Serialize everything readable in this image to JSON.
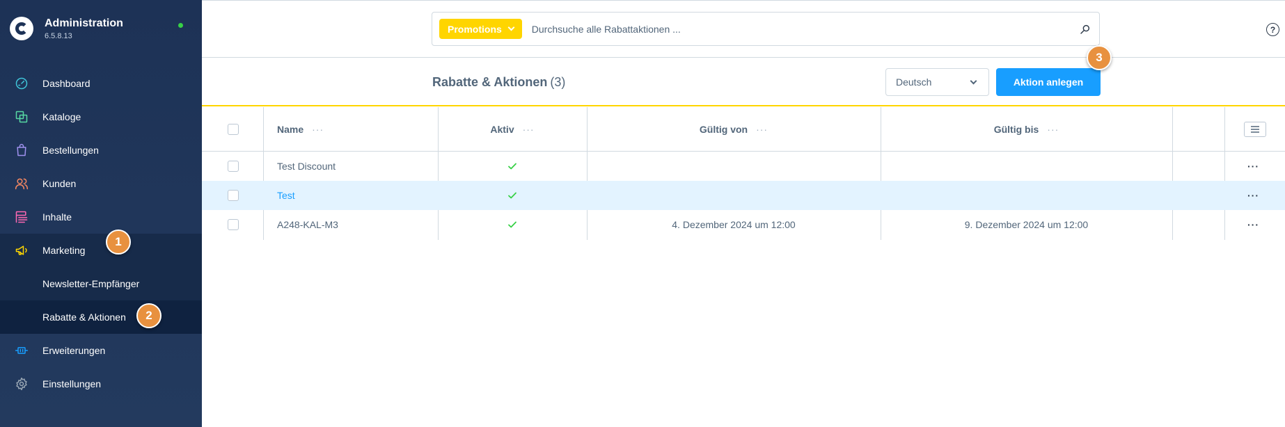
{
  "brand": {
    "title": "Administration",
    "version": "6.5.8.13"
  },
  "sidebar": {
    "items": [
      {
        "label": "Dashboard",
        "icon": "gauge-icon",
        "color": "#3fc4d8"
      },
      {
        "label": "Kataloge",
        "icon": "catalog-icon",
        "color": "#57d9a3"
      },
      {
        "label": "Bestellungen",
        "icon": "shopping-bag-icon",
        "color": "#a092f0"
      },
      {
        "label": "Kunden",
        "icon": "users-icon",
        "color": "#f88962"
      },
      {
        "label": "Inhalte",
        "icon": "content-icon",
        "color": "#ff68b4"
      },
      {
        "label": "Marketing",
        "icon": "megaphone-icon",
        "color": "#ffd700"
      },
      {
        "label": "Newsletter-Empfänger"
      },
      {
        "label": "Rabatte & Aktionen"
      },
      {
        "label": "Erweiterungen",
        "icon": "plug-icon",
        "color": "#189eff"
      },
      {
        "label": "Einstellungen",
        "icon": "gear-icon",
        "color": "#9aa8b5"
      }
    ]
  },
  "badges": [
    "1",
    "2",
    "3"
  ],
  "search": {
    "type_label": "Promotions",
    "placeholder": "Durchsuche alle Rabattaktionen ..."
  },
  "header": {
    "title": "Rabatte & Aktionen",
    "count": "(3)",
    "language": "Deutsch",
    "create_label": "Aktion anlegen"
  },
  "table": {
    "columns": [
      "Name",
      "Aktiv",
      "Gültig von",
      "Gültig bis"
    ],
    "column_menu": "···",
    "rows": [
      {
        "name": "Test Discount",
        "active": true,
        "valid_from": "",
        "valid_until": "",
        "menu": "···"
      },
      {
        "name": "Test",
        "active": true,
        "valid_from": "",
        "valid_until": "",
        "menu": "···"
      },
      {
        "name": "A248-KAL-M3",
        "active": true,
        "valid_from": "4. Dezember 2024 um 12:00",
        "valid_until": "9. Dezember 2024 um 12:00",
        "menu": "···"
      }
    ]
  },
  "colors": {
    "accent": "#189eff",
    "highlight": "#ffd500",
    "badge": "#e8913f",
    "check": "#37d046"
  }
}
